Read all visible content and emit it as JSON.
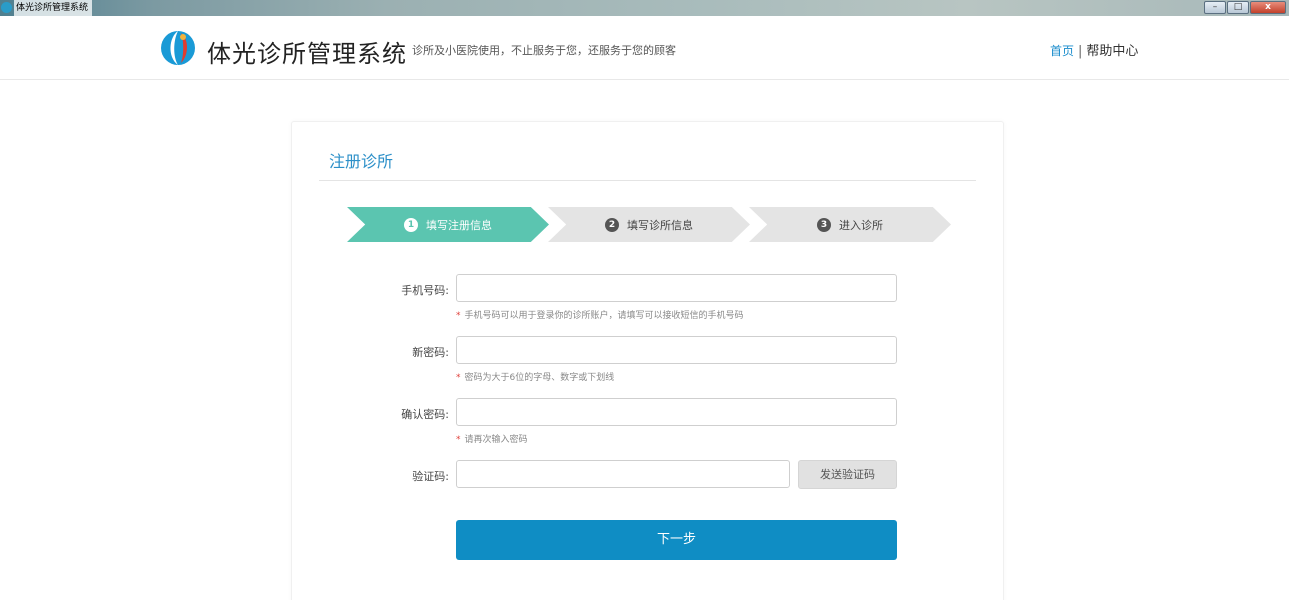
{
  "window": {
    "title": "体光诊所管理系统",
    "controls": {
      "minimize": "–",
      "maximize": "□",
      "close": "x"
    }
  },
  "header": {
    "brand_name": "体光诊所管理系统",
    "slogan": "诊所及小医院使用，不止服务于您，还服务于您的顾客",
    "nav": {
      "home": "首页",
      "separator": "|",
      "help": "帮助中心"
    }
  },
  "card": {
    "title": "注册诊所",
    "steps": [
      {
        "num": "1",
        "label": "填写注册信息",
        "state": "active"
      },
      {
        "num": "2",
        "label": "填写诊所信息",
        "state": "inactive"
      },
      {
        "num": "3",
        "label": "进入诊所",
        "state": "inactive"
      }
    ],
    "form": {
      "phone": {
        "label": "手机号码:",
        "value": "",
        "hint_star": "*",
        "hint": "手机号码可以用于登录你的诊所账户，请填写可以接收短信的手机号码"
      },
      "password": {
        "label": "新密码:",
        "value": "",
        "hint_star": "*",
        "hint": "密码为大于6位的字母、数字或下划线"
      },
      "confirm": {
        "label": "确认密码:",
        "value": "",
        "hint_star": "*",
        "hint": "请再次输入密码"
      },
      "captcha": {
        "label": "验证码:",
        "value": "",
        "send_label": "发送验证码"
      },
      "next_label": "下一步"
    }
  },
  "colors": {
    "accent": "#2b8fc8",
    "step_active": "#5bc5b0",
    "step_inactive": "#e4e4e4",
    "primary_button": "#0f8dc4",
    "required_star": "#e0403a"
  }
}
